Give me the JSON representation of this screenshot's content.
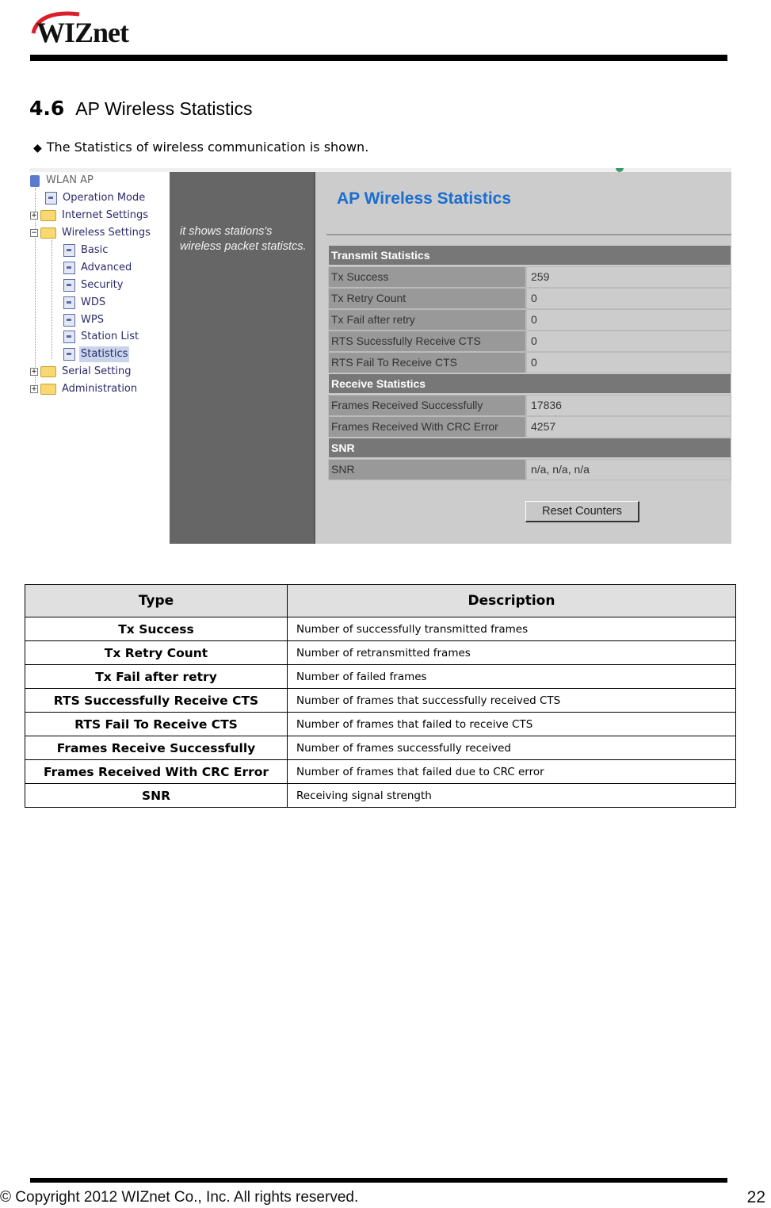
{
  "header": {
    "logo_text": "WIZnet"
  },
  "section": {
    "number": "4.6",
    "title": "AP Wireless Statistics",
    "bullet_text": "The Statistics of wireless communication is shown."
  },
  "screenshot": {
    "tree": {
      "root": "WLAN AP",
      "items": [
        {
          "label": "Operation Mode",
          "type": "page"
        },
        {
          "label": "Internet Settings",
          "type": "folder"
        },
        {
          "label": "Wireless Settings",
          "type": "folder-open"
        },
        {
          "label": "Basic",
          "type": "page"
        },
        {
          "label": "Advanced",
          "type": "page"
        },
        {
          "label": "Security",
          "type": "page"
        },
        {
          "label": "WDS",
          "type": "page"
        },
        {
          "label": "WPS",
          "type": "page"
        },
        {
          "label": "Station List",
          "type": "page"
        },
        {
          "label": "Statistics",
          "type": "page",
          "selected": true
        },
        {
          "label": "Serial Setting",
          "type": "folder"
        },
        {
          "label": "Administration",
          "type": "folder"
        }
      ]
    },
    "help_text": "it shows stations's wireless packet statistcs.",
    "page_title": "AP Wireless Statistics",
    "transmit": {
      "heading": "Transmit Statistics",
      "rows": [
        {
          "label": "Tx Success",
          "value": "259"
        },
        {
          "label": "Tx Retry Count",
          "value": "0"
        },
        {
          "label": "Tx Fail after retry",
          "value": "0"
        },
        {
          "label": "RTS Sucessfully Receive CTS",
          "value": "0"
        },
        {
          "label": "RTS Fail To Receive CTS",
          "value": "0"
        }
      ]
    },
    "receive": {
      "heading": "Receive Statistics",
      "rows": [
        {
          "label": "Frames Received Successfully",
          "value": "17836"
        },
        {
          "label": "Frames Received With CRC Error",
          "value": "4257"
        }
      ]
    },
    "snr": {
      "heading": "SNR",
      "rows": [
        {
          "label": "SNR",
          "value": "n/a, n/a, n/a"
        }
      ]
    },
    "reset_button": "Reset Counters"
  },
  "table": {
    "headers": [
      "Type",
      "Description"
    ],
    "rows": [
      {
        "type": "Tx Success",
        "description": "Number of successfully transmitted frames"
      },
      {
        "type": "Tx Retry Count",
        "description": "Number of retransmitted frames"
      },
      {
        "type": "Tx Fail after retry",
        "description": "Number of failed frames"
      },
      {
        "type": "RTS Successfully Receive CTS",
        "description": "Number of frames that successfully received CTS"
      },
      {
        "type": "RTS Fail To Receive CTS",
        "description": "Number of frames that failed to receive CTS"
      },
      {
        "type": "Frames Receive Successfully",
        "description": "Number of frames successfully received"
      },
      {
        "type": "Frames Received With CRC Error",
        "description": "Number of frames that failed due to CRC error"
      },
      {
        "type": "SNR",
        "description": "Receiving signal strength"
      }
    ]
  },
  "footer": {
    "copyright": "© Copyright 2012 WIZnet Co., Inc. All rights reserved.",
    "page_number": "22"
  }
}
